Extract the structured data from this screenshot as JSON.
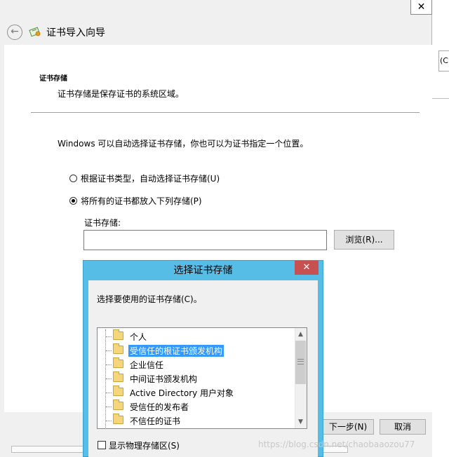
{
  "wizard": {
    "title": "证书导入向导",
    "close_glyph": "✕",
    "section_title": "证书存储",
    "section_desc": "证书存储是保存证书的系统区域。",
    "intro": "Windows 可以自动选择证书存储，你也可以为证书指定一个位置。",
    "option_auto": "根据证书类型，自动选择证书存储(U)",
    "option_manual": "将所有的证书都放入下列存储(P)",
    "store_label": "证书存储:",
    "store_value": "",
    "browse_label": "浏览(R)...",
    "next_label": "下一步(N)",
    "cancel_label": "取消"
  },
  "background_window": {
    "partial_text": "(C"
  },
  "dialog": {
    "title": "选择证书存储",
    "close_glyph": "✕",
    "prompt": "选择要使用的证书存储(C)。",
    "stores": [
      {
        "label": "个人",
        "selected": false
      },
      {
        "label": "受信任的根证书颁发机构",
        "selected": true
      },
      {
        "label": "企业信任",
        "selected": false
      },
      {
        "label": "中间证书颁发机构",
        "selected": false
      },
      {
        "label": "Active Directory 用户对象",
        "selected": false
      },
      {
        "label": "受信任的发布者",
        "selected": false
      },
      {
        "label": "不信任的证书",
        "selected": false
      }
    ],
    "show_physical_label": "显示物理存储区(S)",
    "show_physical_checked": false
  },
  "watermark": "https://blog.csdn.net/chaobaaozou77",
  "icons": {
    "back": "back-arrow-icon",
    "wizard": "certificate-icon",
    "folder": "folder-icon"
  },
  "colors": {
    "dialog_frame": "#56bde6",
    "dialog_close": "#c75050",
    "selection": "#3399ff"
  }
}
